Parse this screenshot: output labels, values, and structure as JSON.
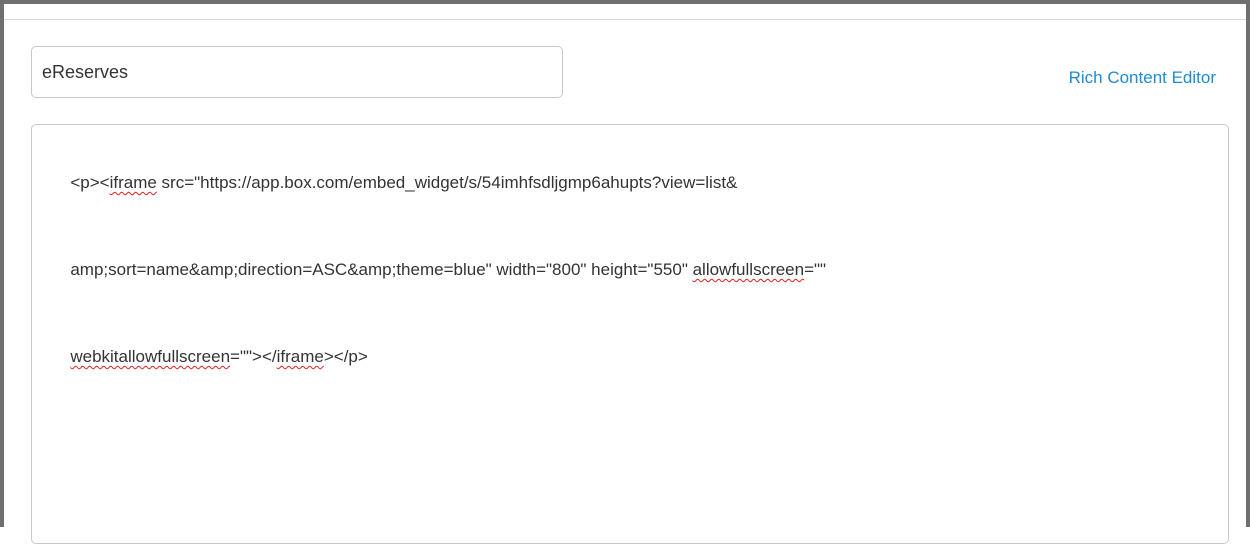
{
  "page_title_input": {
    "value": "eReserves"
  },
  "rich_content_editor_link": "Rich Content Editor",
  "html_editor": {
    "lines": [
      [
        {
          "text": "<p><",
          "misspelled": false
        },
        {
          "text": "iframe",
          "misspelled": true
        },
        {
          "text": " src=\"https://app.box.com/embed_widget/s/54imhfsdljgmp6ahupts?view=list&",
          "misspelled": false
        }
      ],
      [
        {
          "text": "amp;sort=name&amp;direction=ASC&amp;theme=blue\" width=\"800\" height=\"550\" ",
          "misspelled": false
        },
        {
          "text": "allowfullscreen",
          "misspelled": true
        },
        {
          "text": "=\"\"",
          "misspelled": false
        }
      ],
      [
        {
          "text": "webkitallowfullscreen",
          "misspelled": true
        },
        {
          "text": "=\"\"></",
          "misspelled": false
        },
        {
          "text": "iframe",
          "misspelled": true
        },
        {
          "text": "></p>",
          "misspelled": false
        }
      ]
    ]
  }
}
